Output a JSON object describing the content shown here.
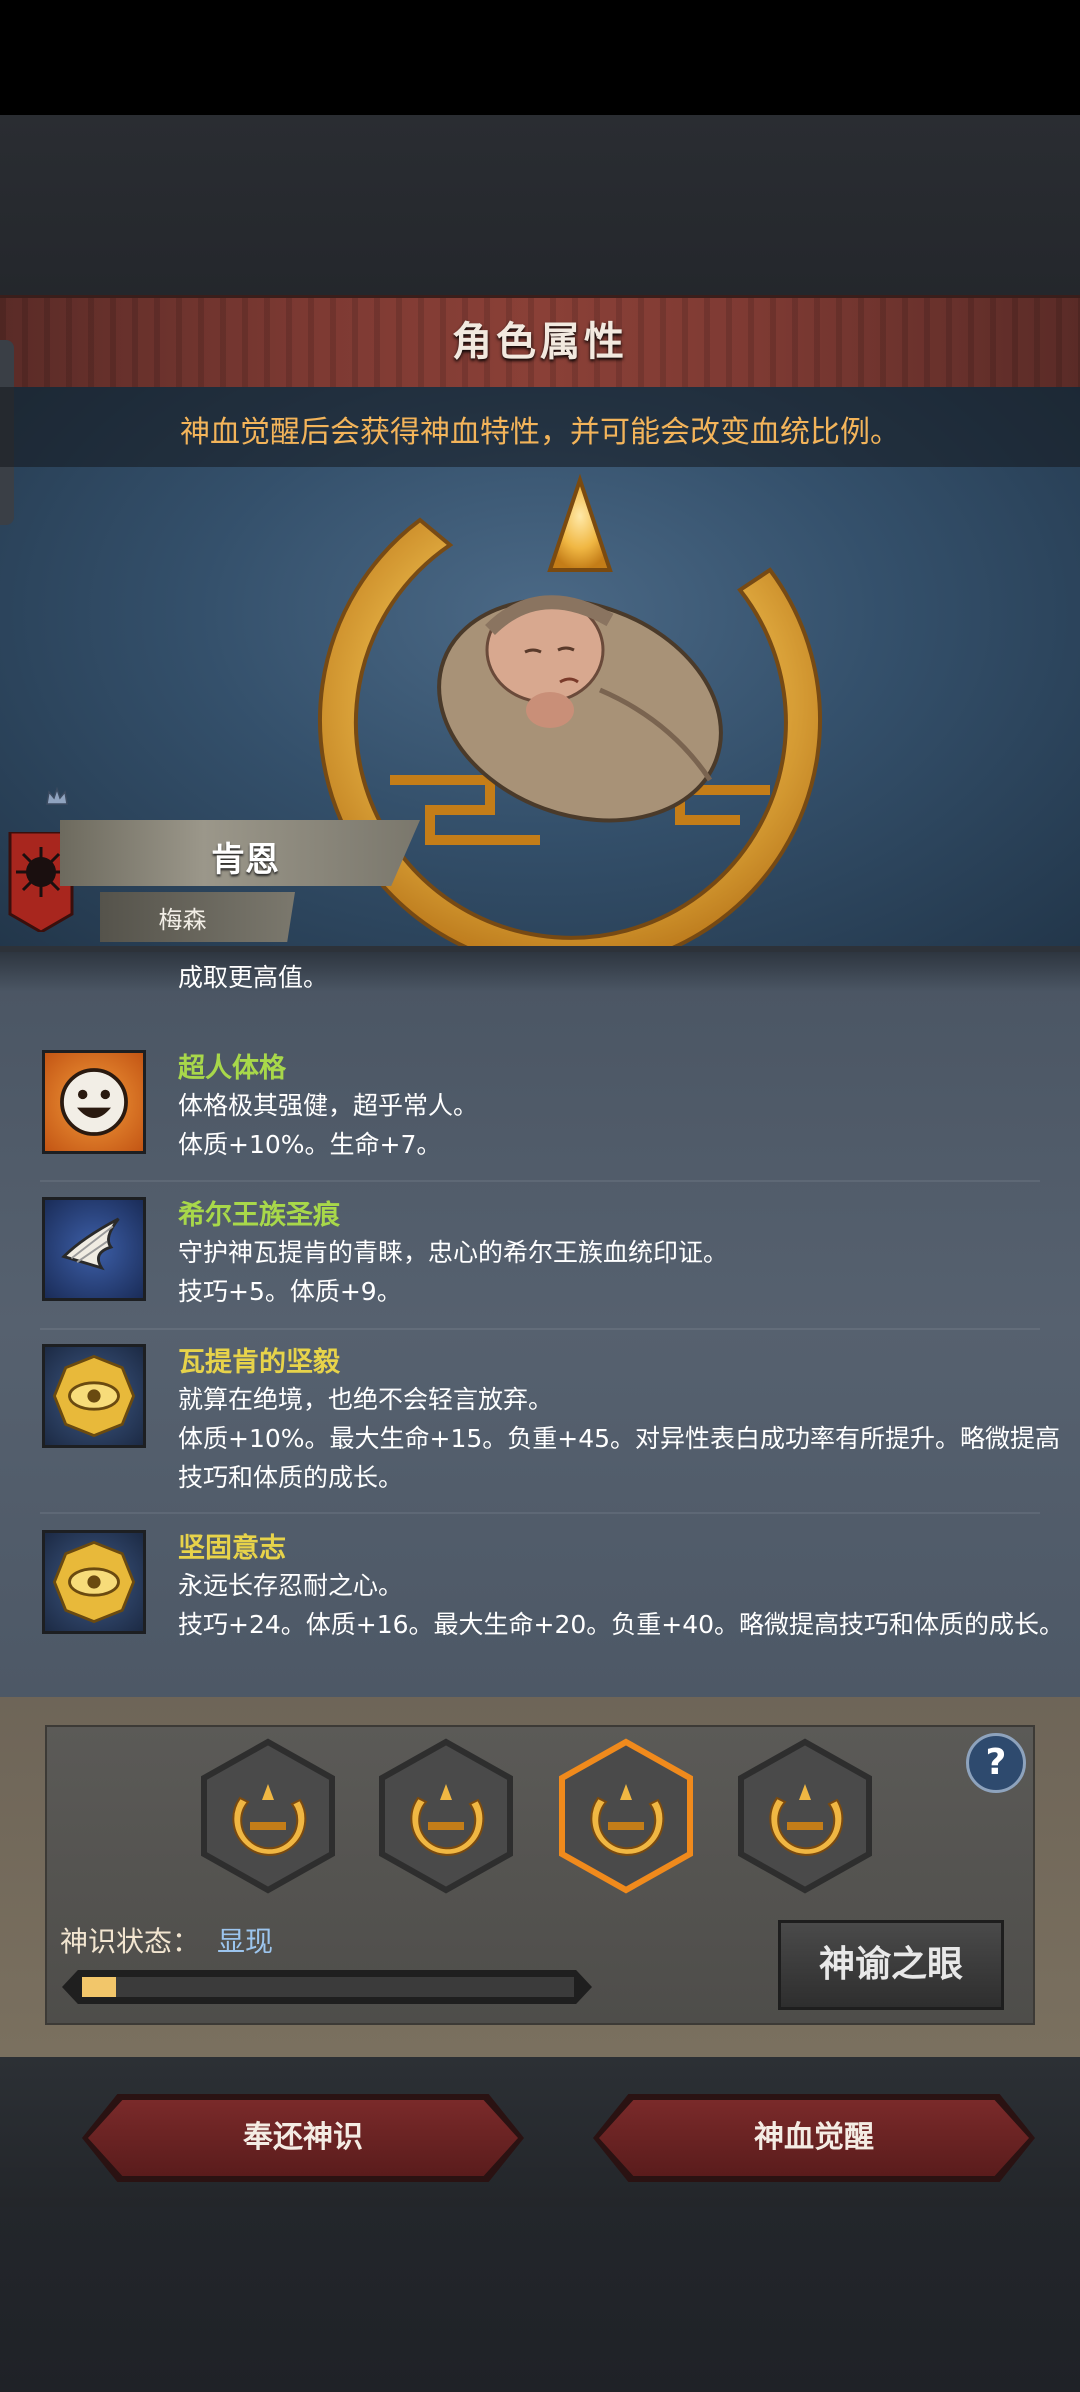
{
  "header": {
    "title": "角色属性",
    "notice": "神血觉醒后会获得神血特性，并可能会改变血统比例。"
  },
  "character": {
    "name": "肯恩",
    "family": "梅森"
  },
  "traits": {
    "partial_text": "成取更高值。",
    "items": [
      {
        "icon": "smiley-face-icon",
        "name": "超人体格",
        "desc": "体格极其强健，超乎常人。",
        "effect": "体质+10%。生命+7。"
      },
      {
        "icon": "white-feather-claw-icon",
        "name": "希尔王族圣痕",
        "desc": "守护神瓦提肯的青睐，忠心的希尔王族血统印证。",
        "effect": "技巧+5。体质+9。"
      },
      {
        "icon": "golden-eye-medallion-icon",
        "name": "瓦提肯的坚毅",
        "desc": "就算在绝境，也绝不会轻言放弃。",
        "effect": "体质+10%。最大生命+15。负重+45。对异性表白成功率有所提升。略微提高技巧和体质的成长。"
      },
      {
        "icon": "golden-eye-medallion-icon",
        "name": "坚固意志",
        "desc": "永远长存忍耐之心。",
        "effect": "技巧+24。体质+16。最大生命+20。负重+40。略微提高技巧和体质的成长。"
      }
    ]
  },
  "divine": {
    "status_label": "神识状态：",
    "status_value": "显现",
    "progress": 0.07,
    "oracle_button": "神谕之眼",
    "help": "?",
    "slots": [
      {
        "icon": "crescent-emblem-icon",
        "selected": false
      },
      {
        "icon": "crescent-emblem-icon",
        "selected": false
      },
      {
        "icon": "crescent-emblem-icon",
        "selected": true
      },
      {
        "icon": "crescent-emblem-icon",
        "selected": false
      }
    ]
  },
  "footer": {
    "return_button": "奉还神识",
    "awaken_button": "神血觉醒"
  },
  "colors": {
    "accent_orange": "#f3b45a",
    "trait_green": "#a8d84a",
    "trait_yellow": "#e7d34a",
    "status_blue": "#9cc5ee",
    "button_red": "#7a2a2a"
  }
}
